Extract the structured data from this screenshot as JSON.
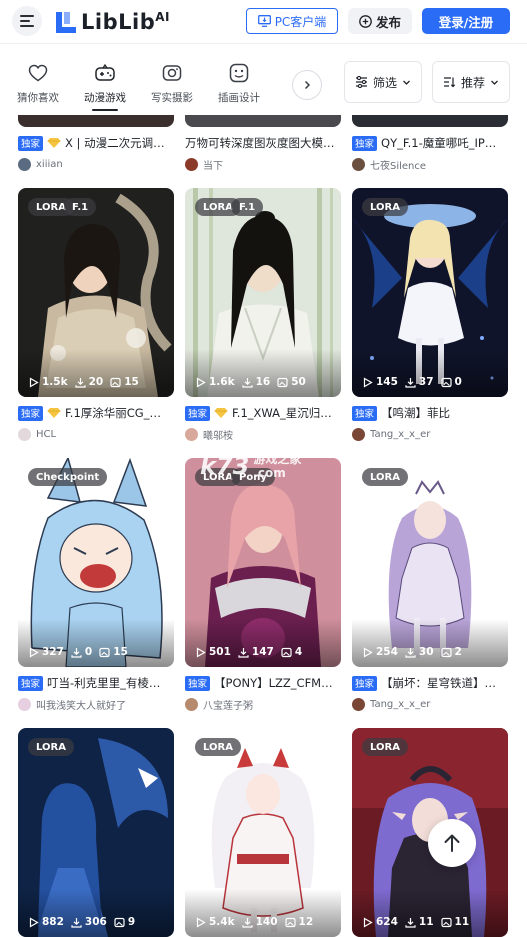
{
  "header": {
    "logo_text": "LibLib",
    "logo_suffix": "AI",
    "pc_client_label": "PC客户端",
    "publish_label": "发布",
    "login_label": "登录/注册"
  },
  "categories": [
    {
      "label": "猜你喜欢",
      "icon": "heart-icon"
    },
    {
      "label": "动漫游戏",
      "icon": "gamepad-icon"
    },
    {
      "label": "写实摄影",
      "icon": "camera-icon"
    },
    {
      "label": "插画设计",
      "icon": "image-icon"
    }
  ],
  "active_category": "动漫游戏",
  "filter_label": "筛选",
  "sort_label": "推荐",
  "top_row": [
    {
      "exclusive": "独家",
      "title": "X | 动漫二次元调…",
      "author": "xiiian"
    },
    {
      "exclusive": "",
      "title": "万物可转深度图灰度图大模…",
      "author": "当下"
    },
    {
      "exclusive": "独家",
      "title": "QY_F.1-魔童哪吒_IP…",
      "author": "七夜Silence"
    }
  ],
  "cards": [
    {
      "badges": [
        "LORA",
        "F.1"
      ],
      "runs": "1.5k",
      "downloads": "20",
      "images": "15",
      "exclusive": "独家",
      "title": "F.1厚涂华丽CG_…",
      "author": "HCL"
    },
    {
      "badges": [
        "LORA",
        "F.1"
      ],
      "runs": "1.6k",
      "downloads": "16",
      "images": "50",
      "exclusive": "独家",
      "title": "F.1_XWA_星沉归…",
      "author": "曦邬桉"
    },
    {
      "badges": [
        "LORA"
      ],
      "runs": "145",
      "downloads": "37",
      "images": "0",
      "exclusive": "独家",
      "title": "【鸣潮】菲比",
      "author": "Tang_x_x_er"
    },
    {
      "badges": [
        "Checkpoint"
      ],
      "runs": "327",
      "downloads": "0",
      "images": "15",
      "exclusive": "独家",
      "title": "叮当-利克里里_有棱…",
      "author": "叫我浅笑大人就好了"
    },
    {
      "badges": [
        "LORA",
        "Pony"
      ],
      "runs": "501",
      "downloads": "147",
      "images": "4",
      "exclusive": "独家",
      "title": "【PONY】LZZ_CFM…",
      "author": "八宝莲子粥"
    },
    {
      "badges": [
        "LORA"
      ],
      "runs": "254",
      "downloads": "30",
      "images": "2",
      "exclusive": "独家",
      "title": "【崩坏：星穹铁道】…",
      "author": "Tang_x_x_er"
    },
    {
      "badges": [
        "LORA"
      ],
      "runs": "882",
      "downloads": "306",
      "images": "9"
    },
    {
      "badges": [
        "LORA"
      ],
      "runs": "5.4k",
      "downloads": "140",
      "images": "12"
    },
    {
      "badges": [
        "LORA"
      ],
      "runs": "624",
      "downloads": "11",
      "images": "11"
    }
  ],
  "watermark": {
    "site": "k73",
    "cn": "游戏之家",
    "dom": ".com"
  },
  "colors": {
    "accent": "#2b6cf6",
    "exclusive_badge": "#2b6cf6",
    "text": "#1f2329"
  }
}
